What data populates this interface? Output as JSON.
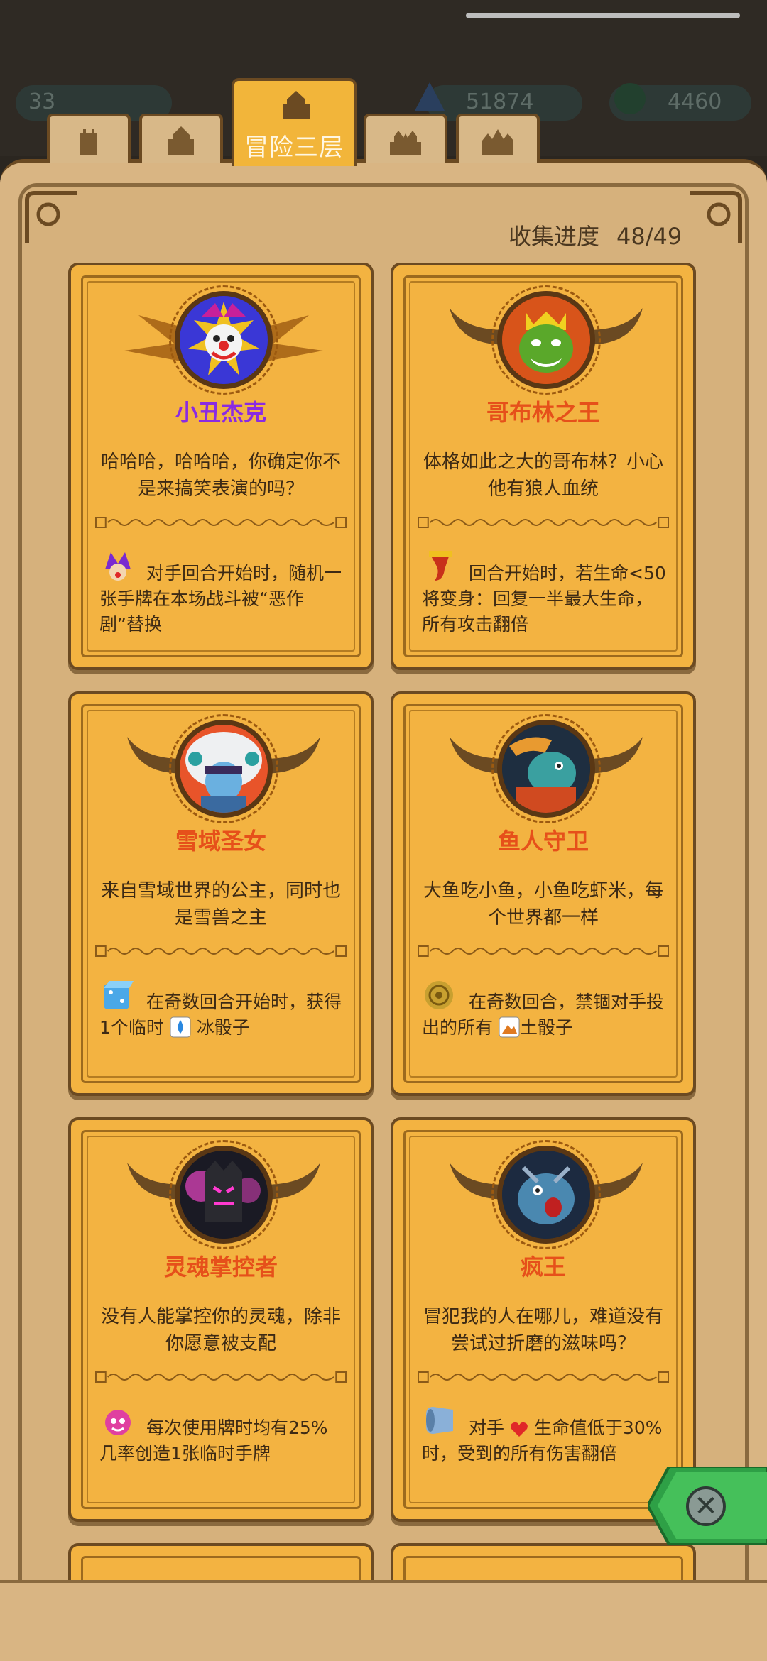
{
  "hud": {
    "left_value": "33",
    "mid_value": "51874",
    "right_value": "4460"
  },
  "tabs": [
    {
      "name": "tab-floor-1",
      "icon": "tower-icon"
    },
    {
      "name": "tab-floor-2",
      "icon": "castle-icon"
    },
    {
      "name": "tab-floor-3",
      "icon": "castle-icon",
      "label": "冒险三层",
      "active": true
    },
    {
      "name": "tab-floor-4",
      "icon": "palace-icon"
    },
    {
      "name": "tab-floor-5",
      "icon": "palace-icon"
    }
  ],
  "collection": {
    "label": "收集进度",
    "value": "48/49"
  },
  "cards": [
    {
      "name": "小丑杰克",
      "name_color": "#8a2be2",
      "desc": "哈哈哈，哈哈哈，你确定你不是来搞笑表演的吗？",
      "ability": "对手回合开始时，随机一张手牌在本场战斗被“恶作剧”替换",
      "ability_icon": "jester-icon"
    },
    {
      "name": "哥布林之王",
      "name_color": "#e6501a",
      "desc": "体格如此之大的哥布林？小心他有狼人血统",
      "ability": "回合开始时，若生命<50将变身：回复一半最大生命，所有攻击翻倍",
      "ability_icon": "horn-icon"
    },
    {
      "name": "雪域圣女",
      "name_color": "#e6501a",
      "desc": "来自雪域世界的公主，同时也是雪兽之主",
      "ability_pre": "在奇数回合开始时，获得1个临时",
      "ability_post": "冰骰子",
      "ability_icon": "ice-dice-icon",
      "inline_icon": "water-drop-icon"
    },
    {
      "name": "鱼人守卫",
      "name_color": "#e6501a",
      "desc": "大鱼吃小鱼，小鱼吃虾米，每个世界都一样",
      "ability_pre": "在奇数回合，禁锢对手投出的所有",
      "ability_post": "土骰子",
      "ability_icon": "shield-coin-icon",
      "inline_icon": "earth-icon"
    },
    {
      "name": "灵魂掌控者",
      "name_color": "#e6501a",
      "desc": "没有人能掌控你的灵魂，除非你愿意被支配",
      "ability": "每次使用牌时均有25%几率创造1张临时手牌",
      "ability_icon": "soul-icon"
    },
    {
      "name": "疯王",
      "name_color": "#e6501a",
      "desc": "冒犯我的人在哪儿，难道没有尝试过折磨的滋味吗？",
      "ability_pre": "对手",
      "ability_post": "生命值低于30%时，受到的所有伤害翻倍",
      "ability_icon": "scroll-horn-icon",
      "inline_icon": "heart-icon"
    }
  ],
  "colors": {
    "card_bg": "#f3b341",
    "panel_bg": "#d9b583",
    "tab_active": "#f2b53a",
    "border": "#6b4a22"
  }
}
